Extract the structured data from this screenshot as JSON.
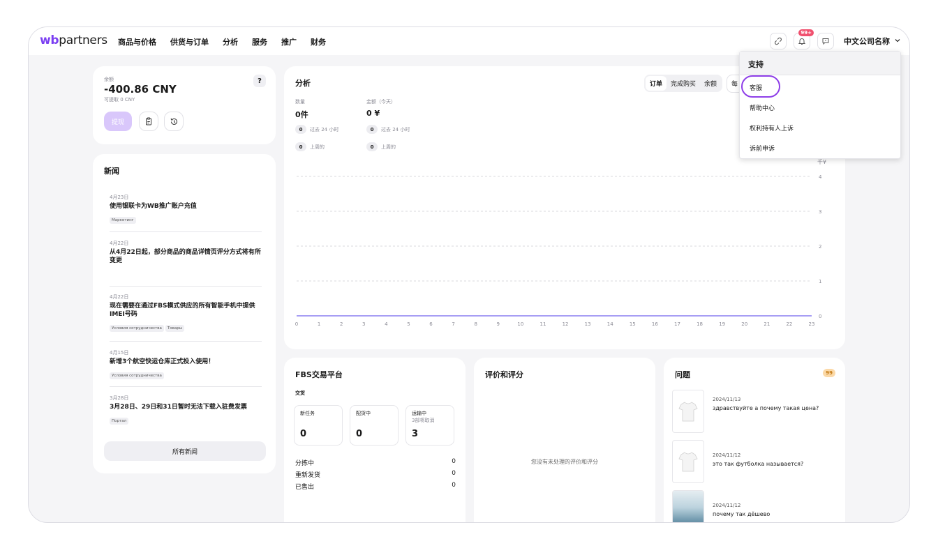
{
  "header": {
    "logo_wb": "wb",
    "logo_partners": "partners",
    "nav": [
      "商品与价格",
      "供货与订单",
      "分析",
      "服务",
      "推广",
      "财务"
    ],
    "notification_badge": "99+",
    "company": "中文公司名称"
  },
  "balance": {
    "label": "余额",
    "amount": "-400.86 CNY",
    "available": "可提取 0 CNY",
    "help": "?",
    "withdraw": "提现"
  },
  "news": {
    "title": "新闻",
    "items": [
      {
        "date": "4月23日",
        "title": "使用银联卡为WB推广账户充值",
        "tags": [
          "Маркетинг"
        ]
      },
      {
        "date": "4月22日",
        "title": "从4月22日起，部分商品的商品详情页评分方式将有所变更",
        "tags": []
      },
      {
        "date": "4月22日",
        "title": "现在需要在通过FBS模式供应的所有智能手机中提供IMEI号码",
        "tags": [
          "Условия сотрудничества",
          "Товары"
        ]
      },
      {
        "date": "4月15日",
        "title": "新增3个航空快运仓库正式投入使用！",
        "tags": [
          "Условия сотрудничества"
        ]
      },
      {
        "date": "3月28日",
        "title": "3月28日、29日和31日暂时无法下载入驻费发票",
        "tags": [
          "Портал"
        ]
      }
    ],
    "all_news": "所有新闻"
  },
  "analytics": {
    "title": "分析",
    "tabs": [
      "订单",
      "完成购买",
      "余额"
    ],
    "period_partial": "每",
    "qty_label": "数量",
    "qty_value": "0件",
    "amount_label": "金额（今天）",
    "amount_value": "0 ¥",
    "qty_24h": "0",
    "qty_24h_label": "过去 24 小时",
    "qty_week": "0",
    "qty_week_label": "上周的",
    "amt_24h": "0",
    "amt_24h_label": "过去 24 小时",
    "amt_week": "0",
    "amt_week_label": "上周的",
    "unit": "千¥"
  },
  "chart_data": {
    "type": "line",
    "x": [
      0,
      1,
      2,
      3,
      4,
      5,
      6,
      7,
      8,
      9,
      10,
      11,
      12,
      13,
      14,
      15,
      16,
      17,
      18,
      19,
      20,
      21,
      22,
      23
    ],
    "series": [
      {
        "values": [
          0,
          0,
          0,
          0,
          0,
          0,
          0,
          0,
          0,
          0,
          0,
          0,
          0,
          0,
          0,
          0,
          0,
          0,
          0,
          0,
          0,
          0,
          0,
          0
        ]
      }
    ],
    "ylim": [
      0,
      4
    ],
    "yticks": [
      "0",
      "1",
      "2",
      "3",
      "4"
    ],
    "ylabel": "千¥",
    "y_axis_position": "right",
    "grid": true,
    "color": "#8a7ff0"
  },
  "fbs": {
    "title": "FBS交易平台",
    "subtitle": "交货",
    "boxes": [
      {
        "label": "新任务",
        "sub": "",
        "value": "0"
      },
      {
        "label": "配货中",
        "sub": "",
        "value": "0"
      },
      {
        "label": "运输中",
        "sub": "3部将取消",
        "value": "3"
      }
    ],
    "rows": [
      {
        "label": "分拣中",
        "value": "0"
      },
      {
        "label": "重新发货",
        "value": "0"
      },
      {
        "label": "已售出",
        "value": "0"
      }
    ]
  },
  "reviews": {
    "title": "评价和评分",
    "empty": "您没有未处理的评价和评分"
  },
  "questions": {
    "title": "问题",
    "badge": "99",
    "items": [
      {
        "date": "2024/11/13",
        "text": "здравствуйте а почему такая цена?"
      },
      {
        "date": "2024/11/12",
        "text": "это так футболка называется?"
      },
      {
        "date": "2024/11/12",
        "text": "почему так дёшево"
      }
    ]
  },
  "dropdown": {
    "title": "支持",
    "items": [
      "客服",
      "帮助中心",
      "权利持有人上诉",
      "诉前申诉"
    ]
  },
  "colors": {
    "brand": "#7b3ff2",
    "highlight": "#8e3ee8",
    "badge": "#f0506e",
    "question_badge": "#fbd9a8"
  }
}
